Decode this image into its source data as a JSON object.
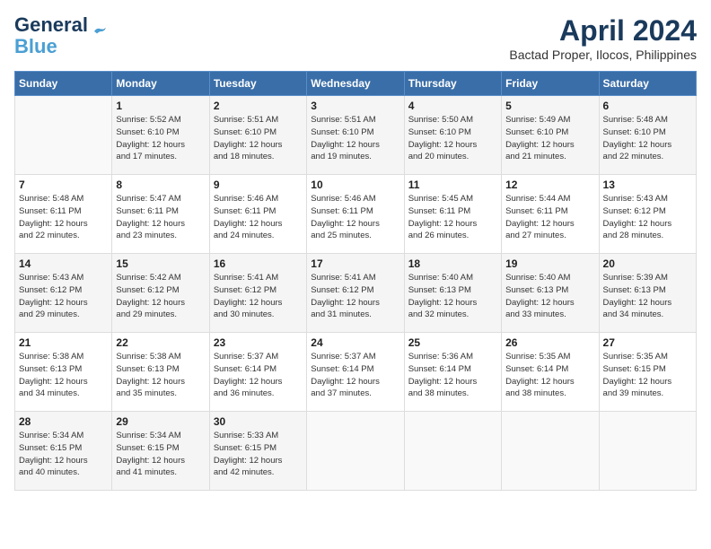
{
  "header": {
    "logo_line1": "General",
    "logo_line2": "Blue",
    "month": "April 2024",
    "location": "Bactad Proper, Ilocos, Philippines"
  },
  "weekdays": [
    "Sunday",
    "Monday",
    "Tuesday",
    "Wednesday",
    "Thursday",
    "Friday",
    "Saturday"
  ],
  "weeks": [
    [
      {
        "day": "",
        "info": ""
      },
      {
        "day": "1",
        "info": "Sunrise: 5:52 AM\nSunset: 6:10 PM\nDaylight: 12 hours\nand 17 minutes."
      },
      {
        "day": "2",
        "info": "Sunrise: 5:51 AM\nSunset: 6:10 PM\nDaylight: 12 hours\nand 18 minutes."
      },
      {
        "day": "3",
        "info": "Sunrise: 5:51 AM\nSunset: 6:10 PM\nDaylight: 12 hours\nand 19 minutes."
      },
      {
        "day": "4",
        "info": "Sunrise: 5:50 AM\nSunset: 6:10 PM\nDaylight: 12 hours\nand 20 minutes."
      },
      {
        "day": "5",
        "info": "Sunrise: 5:49 AM\nSunset: 6:10 PM\nDaylight: 12 hours\nand 21 minutes."
      },
      {
        "day": "6",
        "info": "Sunrise: 5:48 AM\nSunset: 6:10 PM\nDaylight: 12 hours\nand 22 minutes."
      }
    ],
    [
      {
        "day": "7",
        "info": "Sunrise: 5:48 AM\nSunset: 6:11 PM\nDaylight: 12 hours\nand 22 minutes."
      },
      {
        "day": "8",
        "info": "Sunrise: 5:47 AM\nSunset: 6:11 PM\nDaylight: 12 hours\nand 23 minutes."
      },
      {
        "day": "9",
        "info": "Sunrise: 5:46 AM\nSunset: 6:11 PM\nDaylight: 12 hours\nand 24 minutes."
      },
      {
        "day": "10",
        "info": "Sunrise: 5:46 AM\nSunset: 6:11 PM\nDaylight: 12 hours\nand 25 minutes."
      },
      {
        "day": "11",
        "info": "Sunrise: 5:45 AM\nSunset: 6:11 PM\nDaylight: 12 hours\nand 26 minutes."
      },
      {
        "day": "12",
        "info": "Sunrise: 5:44 AM\nSunset: 6:11 PM\nDaylight: 12 hours\nand 27 minutes."
      },
      {
        "day": "13",
        "info": "Sunrise: 5:43 AM\nSunset: 6:12 PM\nDaylight: 12 hours\nand 28 minutes."
      }
    ],
    [
      {
        "day": "14",
        "info": "Sunrise: 5:43 AM\nSunset: 6:12 PM\nDaylight: 12 hours\nand 29 minutes."
      },
      {
        "day": "15",
        "info": "Sunrise: 5:42 AM\nSunset: 6:12 PM\nDaylight: 12 hours\nand 29 minutes."
      },
      {
        "day": "16",
        "info": "Sunrise: 5:41 AM\nSunset: 6:12 PM\nDaylight: 12 hours\nand 30 minutes."
      },
      {
        "day": "17",
        "info": "Sunrise: 5:41 AM\nSunset: 6:12 PM\nDaylight: 12 hours\nand 31 minutes."
      },
      {
        "day": "18",
        "info": "Sunrise: 5:40 AM\nSunset: 6:13 PM\nDaylight: 12 hours\nand 32 minutes."
      },
      {
        "day": "19",
        "info": "Sunrise: 5:40 AM\nSunset: 6:13 PM\nDaylight: 12 hours\nand 33 minutes."
      },
      {
        "day": "20",
        "info": "Sunrise: 5:39 AM\nSunset: 6:13 PM\nDaylight: 12 hours\nand 34 minutes."
      }
    ],
    [
      {
        "day": "21",
        "info": "Sunrise: 5:38 AM\nSunset: 6:13 PM\nDaylight: 12 hours\nand 34 minutes."
      },
      {
        "day": "22",
        "info": "Sunrise: 5:38 AM\nSunset: 6:13 PM\nDaylight: 12 hours\nand 35 minutes."
      },
      {
        "day": "23",
        "info": "Sunrise: 5:37 AM\nSunset: 6:14 PM\nDaylight: 12 hours\nand 36 minutes."
      },
      {
        "day": "24",
        "info": "Sunrise: 5:37 AM\nSunset: 6:14 PM\nDaylight: 12 hours\nand 37 minutes."
      },
      {
        "day": "25",
        "info": "Sunrise: 5:36 AM\nSunset: 6:14 PM\nDaylight: 12 hours\nand 38 minutes."
      },
      {
        "day": "26",
        "info": "Sunrise: 5:35 AM\nSunset: 6:14 PM\nDaylight: 12 hours\nand 38 minutes."
      },
      {
        "day": "27",
        "info": "Sunrise: 5:35 AM\nSunset: 6:15 PM\nDaylight: 12 hours\nand 39 minutes."
      }
    ],
    [
      {
        "day": "28",
        "info": "Sunrise: 5:34 AM\nSunset: 6:15 PM\nDaylight: 12 hours\nand 40 minutes."
      },
      {
        "day": "29",
        "info": "Sunrise: 5:34 AM\nSunset: 6:15 PM\nDaylight: 12 hours\nand 41 minutes."
      },
      {
        "day": "30",
        "info": "Sunrise: 5:33 AM\nSunset: 6:15 PM\nDaylight: 12 hours\nand 42 minutes."
      },
      {
        "day": "",
        "info": ""
      },
      {
        "day": "",
        "info": ""
      },
      {
        "day": "",
        "info": ""
      },
      {
        "day": "",
        "info": ""
      }
    ]
  ]
}
